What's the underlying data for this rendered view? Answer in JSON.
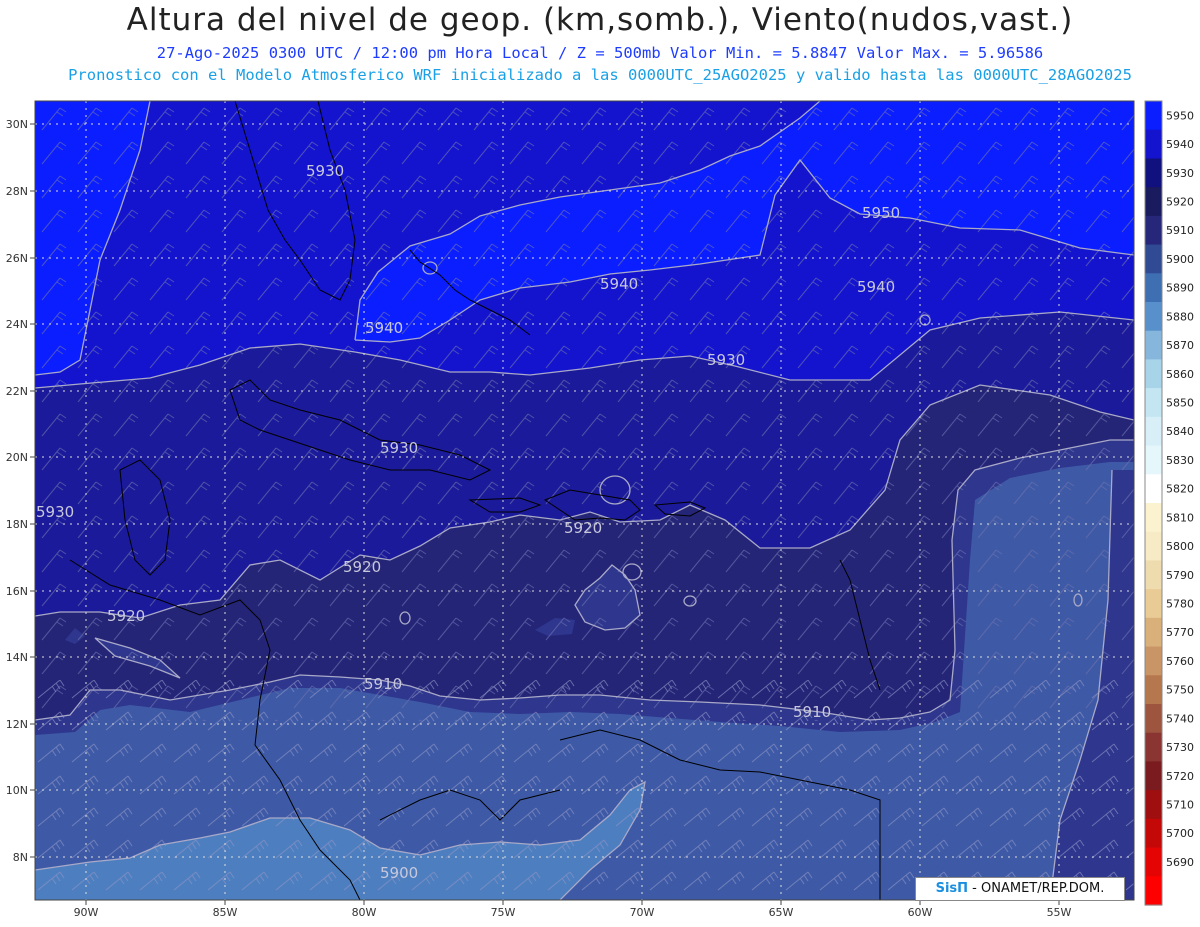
{
  "header": {
    "title": "Altura del nivel de geop. (km,somb.), Viento(nudos,vast.)",
    "subtitle1": "27-Ago-2025  0300 UTC / 12:00 pm Hora Local / Z = 500mb     Valor Min. = 5.8847  Valor Max. = 5.96586",
    "subtitle2": "Pronostico con el Modelo Atmosferico WRF inicializado a las 0000UTC_25AGO2025 y valido hasta las  0000UTC_28AGO2025"
  },
  "map": {
    "lat_ticks": [
      "30N",
      "28N",
      "26N",
      "24N",
      "22N",
      "20N",
      "18N",
      "16N",
      "14N",
      "12N",
      "10N",
      "8N"
    ],
    "lon_ticks": [
      "90W",
      "85W",
      "80W",
      "75W",
      "70W",
      "65W",
      "60W",
      "55W"
    ],
    "contour_labels": [
      "5930",
      "5950",
      "5940",
      "5940",
      "5940",
      "5930",
      "5930",
      "5930",
      "5920",
      "5920",
      "5920",
      "5910",
      "5910",
      "5900"
    ],
    "colors": {
      "c5950": "#0a1eff",
      "c5940": "#1414cf",
      "c5930": "#1b1a9a",
      "c5920": "#252578",
      "c5910": "#2e368e",
      "c5900": "#3e5aa6",
      "c5890": "#4d7fc0",
      "contour": "#a9a9c8",
      "coast": "#000000",
      "wind": "#6f72b0"
    }
  },
  "colorbar": {
    "levels": [
      "5950",
      "5940",
      "5930",
      "5920",
      "5910",
      "5900",
      "5890",
      "5880",
      "5870",
      "5860",
      "5850",
      "5840",
      "5830",
      "5820",
      "5810",
      "5800",
      "5790",
      "5780",
      "5770",
      "5760",
      "5750",
      "5740",
      "5730",
      "5720",
      "5710",
      "5700",
      "5690"
    ],
    "colors": [
      "#0a1eff",
      "#1414cf",
      "#10107e",
      "#1a1a5e",
      "#26267a",
      "#314a94",
      "#3e6fb3",
      "#5890cb",
      "#86b6dc",
      "#a8d4ea",
      "#c4e6f2",
      "#d8eff8",
      "#e6f7fb",
      "#ffffff",
      "#fbf3cf",
      "#f6ebc5",
      "#efdcae",
      "#e9cb95",
      "#d9b07a",
      "#c99466",
      "#b5774d",
      "#9e5540",
      "#8a3532",
      "#7a1c1f",
      "#a00f0f",
      "#c40808",
      "#e40404",
      "#ff0000"
    ]
  },
  "credit": {
    "brand": "SisΠ",
    "org": " - ONAMET/REP.DOM."
  }
}
